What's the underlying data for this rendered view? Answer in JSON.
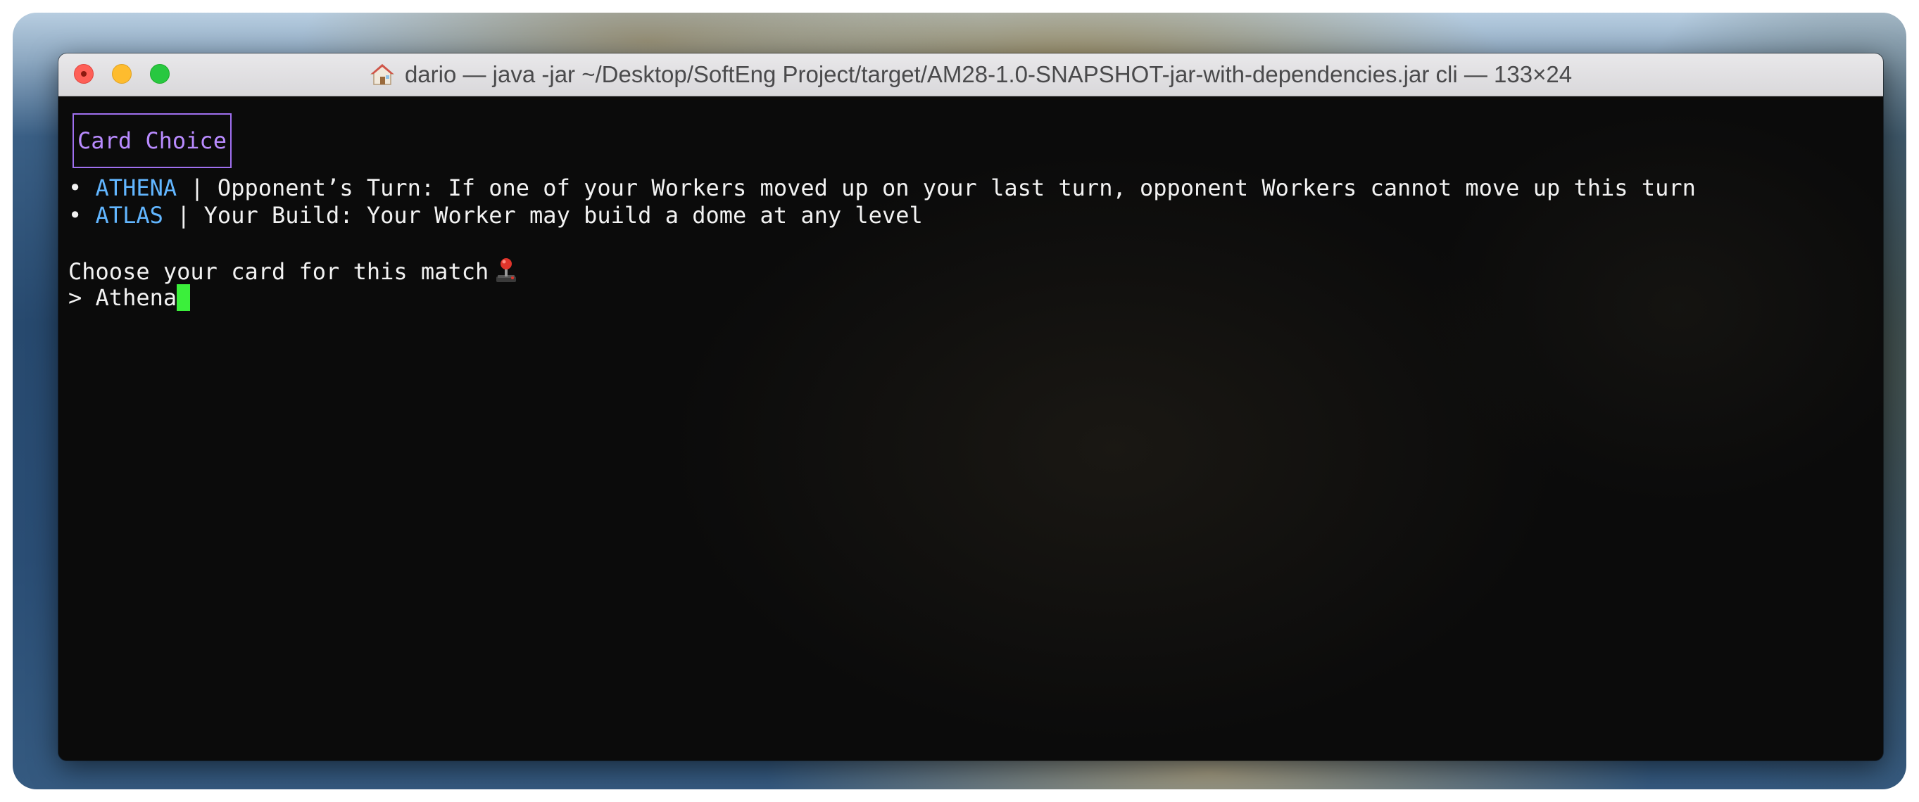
{
  "window": {
    "title": "dario — java -jar ~/Desktop/SoftEng Project/target/AM28-1.0-SNAPSHOT-jar-with-dependencies.jar cli — 133×24",
    "title_icon": "house-icon"
  },
  "terminal": {
    "header_box": "Card Choice",
    "cards": [
      {
        "bullet": "•",
        "name": "ATHENA",
        "separator": "|",
        "description": "Opponent’s Turn: If one of your Workers moved up on your last turn, opponent Workers cannot move up this turn"
      },
      {
        "bullet": "•",
        "name": "ATLAS",
        "separator": "|",
        "description": "Your Build: Your Worker may build a dome at any level"
      }
    ],
    "prompt_text": "Choose your card for this match",
    "prompt_icon": "joystick-icon",
    "input_prefix": ">",
    "input_value": "Athena"
  },
  "colors": {
    "card_name": "#62b6ff",
    "header_box": "#b98bff",
    "cursor": "#3bef3b"
  }
}
